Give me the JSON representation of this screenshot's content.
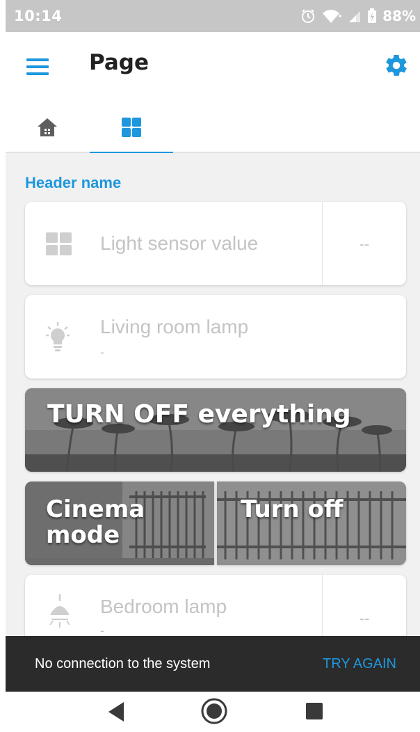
{
  "status_bar": {
    "time": "10:14",
    "battery": "88%",
    "icons": [
      "alarm-icon",
      "wifi-icon",
      "signal-icon",
      "battery-charging-icon"
    ]
  },
  "app_bar": {
    "title": "Page",
    "left_icon": "menu-icon",
    "right_icon": "gear-icon",
    "accent_color": "#1d97dd"
  },
  "tabs": [
    {
      "icon": "home-icon",
      "selected": false
    },
    {
      "icon": "grid-icon",
      "selected": true
    }
  ],
  "section": {
    "header": "Header name"
  },
  "cards": {
    "light_sensor": {
      "label": "Light sensor value",
      "value": "--",
      "icon": "grid-icon"
    },
    "living_room": {
      "label": "Living room lamp",
      "sublabel": "-",
      "icon": "lightbulb-icon"
    },
    "bedroom": {
      "label": "Bedroom lamp",
      "sublabel": "-",
      "value": "--",
      "icon": "ceiling-lamp-icon"
    }
  },
  "scenes": {
    "turn_off_everything": "TURN OFF everything",
    "cinema_mode_line1": "Cinema",
    "cinema_mode_line2": "mode",
    "turn_off": "Turn off"
  },
  "snackbar": {
    "message": "No connection to the system",
    "action": "TRY AGAIN"
  },
  "nav_bar": {
    "buttons": [
      "back-icon",
      "home-circle-icon",
      "recents-icon"
    ]
  }
}
